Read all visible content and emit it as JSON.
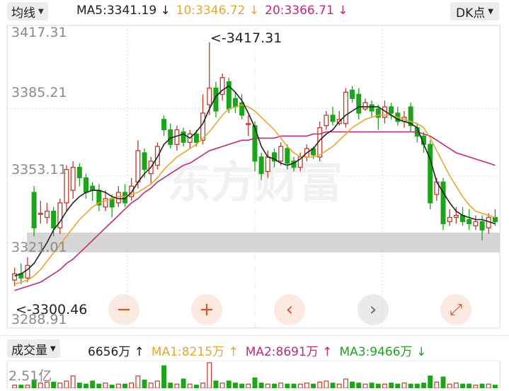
{
  "header": {
    "indicator_label": "均线",
    "ma5": {
      "label": "MA5:3341.19",
      "arrow": "↓",
      "color": "#222222"
    },
    "ma10": {
      "label": "10:3346.72",
      "arrow": "↓",
      "color": "#e8a530"
    },
    "ma20": {
      "label": "20:3366.71",
      "arrow": "↓",
      "color": "#c0287a"
    },
    "period_label": "DK点"
  },
  "price_axis": {
    "ticks": [
      "3417.31",
      "3385.21",
      "3353.11",
      "3321.01",
      "3288.91"
    ],
    "tick_values": [
      3417.31,
      3385.21,
      3353.11,
      3321.01,
      3288.91
    ],
    "high_marker": "<-3417.31",
    "low_marker": "<-3300.46"
  },
  "watermark": "东方财富",
  "controls": {
    "zoom_out": "−",
    "zoom_in": "+",
    "prev": "‹",
    "next": "›",
    "fullscreen": "⤢"
  },
  "volume": {
    "indicator_label": "成交量",
    "current": "6656万",
    "current_arrow": "↑",
    "ma1": {
      "label": "MA1:8215万",
      "arrow": "↑",
      "color": "#e8a530"
    },
    "ma2": {
      "label": "MA2:8691万",
      "arrow": "↑",
      "color": "#c0287a"
    },
    "ma3": {
      "label": "MA3:9466万",
      "arrow": "↓",
      "color": "#1aa51a"
    },
    "axis_top": "2.51亿"
  },
  "colors": {
    "up": "#c0392b",
    "down": "#1aa51a",
    "grid": "#dcdcdc"
  },
  "chart_data": {
    "type": "candlestick",
    "candles": [
      [
        3303,
        3306,
        3309,
        3300
      ],
      [
        3306,
        3304,
        3311,
        3301
      ],
      [
        3304,
        3310,
        3314,
        3302
      ],
      [
        3345,
        3328,
        3348,
        3324
      ],
      [
        3335,
        3335,
        3341,
        3330
      ],
      [
        3333,
        3336,
        3340,
        3330
      ],
      [
        3336,
        3328,
        3338,
        3324
      ],
      [
        3328,
        3340,
        3342,
        3325
      ],
      [
        3340,
        3356,
        3358,
        3336
      ],
      [
        3346,
        3357,
        3360,
        3342
      ],
      [
        3357,
        3352,
        3359,
        3348
      ],
      [
        3352,
        3345,
        3354,
        3342
      ],
      [
        3348,
        3346,
        3350,
        3341
      ],
      [
        3346,
        3339,
        3349,
        3336
      ],
      [
        3338,
        3342,
        3346,
        3336
      ],
      [
        3342,
        3338,
        3344,
        3333
      ],
      [
        3340,
        3345,
        3348,
        3338
      ],
      [
        3345,
        3340,
        3349,
        3338
      ],
      [
        3343,
        3348,
        3352,
        3341
      ],
      [
        3350,
        3365,
        3370,
        3347
      ],
      [
        3364,
        3356,
        3366,
        3352
      ],
      [
        3354,
        3360,
        3362,
        3349
      ],
      [
        3358,
        3367,
        3369,
        3356
      ],
      [
        3380,
        3375,
        3382,
        3372
      ],
      [
        3375,
        3368,
        3378,
        3366
      ],
      [
        3368,
        3375,
        3377,
        3365
      ],
      [
        3374,
        3369,
        3376,
        3367
      ],
      [
        3369,
        3373,
        3375,
        3366
      ],
      [
        3373,
        3369,
        3375,
        3367
      ],
      [
        3370,
        3383,
        3392,
        3368
      ],
      [
        3387,
        3395,
        3417,
        3382
      ],
      [
        3395,
        3384,
        3398,
        3381
      ],
      [
        3392,
        3400,
        3402,
        3389
      ],
      [
        3398,
        3385,
        3400,
        3383
      ],
      [
        3390,
        3386,
        3393,
        3383
      ],
      [
        3388,
        3382,
        3392,
        3380
      ],
      [
        3378,
        3378,
        3382,
        3372
      ],
      [
        3377,
        3360,
        3379,
        3355
      ],
      [
        3362,
        3354,
        3364,
        3351
      ],
      [
        3355,
        3362,
        3365,
        3352
      ],
      [
        3364,
        3360,
        3366,
        3357
      ],
      [
        3360,
        3367,
        3369,
        3358
      ],
      [
        3366,
        3359,
        3368,
        3356
      ],
      [
        3360,
        3357,
        3362,
        3355
      ],
      [
        3357,
        3362,
        3364,
        3355
      ],
      [
        3362,
        3366,
        3368,
        3360
      ],
      [
        3366,
        3363,
        3367,
        3361
      ],
      [
        3362,
        3376,
        3379,
        3360
      ],
      [
        3377,
        3382,
        3384,
        3375
      ],
      [
        3382,
        3379,
        3386,
        3377
      ],
      [
        3378,
        3380,
        3384,
        3377
      ],
      [
        3378,
        3393,
        3395,
        3376
      ],
      [
        3394,
        3390,
        3396,
        3388
      ],
      [
        3392,
        3383,
        3395,
        3380
      ],
      [
        3385,
        3388,
        3390,
        3384
      ],
      [
        3387,
        3384,
        3389,
        3381
      ],
      [
        3385,
        3381,
        3387,
        3375
      ],
      [
        3381,
        3386,
        3389,
        3378
      ],
      [
        3386,
        3383,
        3388,
        3380
      ],
      [
        3383,
        3379,
        3386,
        3377
      ],
      [
        3379,
        3381,
        3384,
        3376
      ],
      [
        3386,
        3377,
        3388,
        3374
      ],
      [
        3376,
        3372,
        3378,
        3369
      ],
      [
        3372,
        3368,
        3374,
        3364
      ],
      [
        3368,
        3340,
        3370,
        3337
      ],
      [
        3344,
        3350,
        3352,
        3341
      ],
      [
        3350,
        3330,
        3352,
        3327
      ],
      [
        3331,
        3333,
        3337,
        3329
      ],
      [
        3333,
        3334,
        3338,
        3330
      ],
      [
        3334,
        3331,
        3338,
        3329
      ],
      [
        3332,
        3330,
        3337,
        3327
      ],
      [
        3329,
        3331,
        3334,
        3327
      ],
      [
        3331,
        3327,
        3334,
        3322
      ],
      [
        3328,
        3333,
        3335,
        3325
      ],
      [
        3333,
        3331,
        3337,
        3329
      ]
    ],
    "ma5": [
      3305,
      3306,
      3308,
      3311,
      3316,
      3321,
      3327,
      3331,
      3336,
      3340,
      3343,
      3345,
      3346,
      3346,
      3345,
      3343,
      3342,
      3342,
      3345,
      3350,
      3354,
      3357,
      3362,
      3368,
      3371,
      3372,
      3373,
      3371,
      3374,
      3378,
      3385,
      3391,
      3394,
      3396,
      3393,
      3389,
      3383,
      3376,
      3367,
      3362,
      3361,
      3359,
      3358,
      3359,
      3361,
      3364,
      3366,
      3370,
      3373,
      3375,
      3379,
      3382,
      3384,
      3386,
      3386,
      3386,
      3386,
      3384,
      3382,
      3380,
      3379,
      3378,
      3376,
      3368,
      3361,
      3350,
      3345,
      3340,
      3336,
      3334,
      3333,
      3332,
      3332,
      3331,
      3330
    ],
    "ma10": [
      3301,
      3302,
      3303,
      3305,
      3308,
      3312,
      3316,
      3320,
      3324,
      3328,
      3332,
      3335,
      3338,
      3340,
      3341,
      3342,
      3343,
      3343,
      3344,
      3345,
      3347,
      3349,
      3352,
      3356,
      3359,
      3362,
      3364,
      3366,
      3368,
      3371,
      3374,
      3378,
      3382,
      3385,
      3386,
      3387,
      3386,
      3384,
      3381,
      3378,
      3375,
      3371,
      3367,
      3364,
      3362,
      3362,
      3362,
      3363,
      3365,
      3367,
      3370,
      3373,
      3376,
      3378,
      3380,
      3381,
      3382,
      3382,
      3382,
      3381,
      3380,
      3379,
      3378,
      3376,
      3371,
      3365,
      3359,
      3353,
      3348,
      3343,
      3339,
      3336,
      3335,
      3334,
      3333
    ],
    "ma20": [
      3298,
      3299,
      3300,
      3301,
      3302,
      3304,
      3306,
      3308,
      3311,
      3313,
      3316,
      3319,
      3322,
      3325,
      3328,
      3331,
      3334,
      3337,
      3340,
      3342,
      3345,
      3347,
      3350,
      3352,
      3354,
      3356,
      3358,
      3359,
      3361,
      3363,
      3365,
      3366,
      3367,
      3368,
      3369,
      3370,
      3370,
      3371,
      3371,
      3371,
      3371,
      3372,
      3372,
      3372,
      3372,
      3372,
      3373,
      3373,
      3374,
      3374,
      3374,
      3374,
      3374,
      3374,
      3374,
      3374,
      3374,
      3374,
      3374,
      3374,
      3374,
      3374,
      3374,
      3373,
      3372,
      3370,
      3368,
      3366,
      3364,
      3363,
      3362,
      3361,
      3360,
      3359,
      3358
    ],
    "volume": [
      3,
      3,
      3,
      8,
      5,
      6,
      6,
      5,
      7,
      12,
      5,
      4,
      7,
      4,
      5,
      3,
      4,
      4,
      5,
      12,
      8,
      5,
      7,
      22,
      5,
      4,
      9,
      4,
      3,
      5,
      25,
      7,
      5,
      7,
      5,
      4,
      4,
      10,
      5,
      4,
      4,
      5,
      4,
      4,
      4,
      5,
      4,
      6,
      7,
      5,
      4,
      9,
      6,
      5,
      4,
      5,
      4,
      4,
      5,
      4,
      5,
      4,
      4,
      5,
      12,
      6,
      11,
      4,
      5,
      4,
      4,
      3,
      4,
      4,
      3
    ],
    "y_range": [
      3280,
      3425
    ]
  }
}
